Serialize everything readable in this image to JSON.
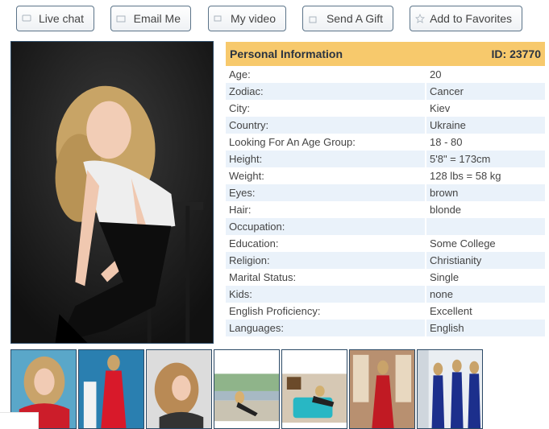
{
  "buttons": {
    "live_chat": "Live chat",
    "email_me": "Email Me",
    "my_video": "My video",
    "send_gift": "Send A Gift",
    "add_favorites": "Add to Favorites"
  },
  "profile": {
    "header_title": "Personal Information",
    "id_label": "ID: 23770",
    "rows": [
      {
        "label": "Age:",
        "value": "20"
      },
      {
        "label": "Zodiac:",
        "value": "Cancer"
      },
      {
        "label": "City:",
        "value": "Kiev"
      },
      {
        "label": "Country:",
        "value": "Ukraine"
      },
      {
        "label": "Looking For An Age Group:",
        "value": "18 - 80"
      },
      {
        "label": "Height:",
        "value": "5'8\" = 173cm"
      },
      {
        "label": "Weight:",
        "value": "128 lbs = 58 kg"
      },
      {
        "label": "Eyes:",
        "value": "brown"
      },
      {
        "label": "Hair:",
        "value": "blonde"
      },
      {
        "label": "Occupation:",
        "value": ""
      },
      {
        "label": "Education:",
        "value": "Some College"
      },
      {
        "label": "Religion:",
        "value": "Christianity"
      },
      {
        "label": "Marital Status:",
        "value": "Single"
      },
      {
        "label": "Kids:",
        "value": "none"
      },
      {
        "label": "English Proficiency:",
        "value": "Excellent"
      },
      {
        "label": "Languages:",
        "value": "English"
      }
    ]
  },
  "colors": {
    "header_bg": "#f7c96c",
    "row_alt_bg": "#eaf2fa",
    "border": "#2c4a66"
  }
}
